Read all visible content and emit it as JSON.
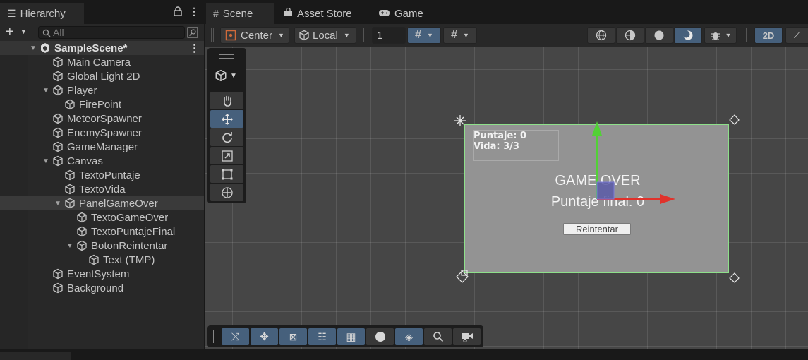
{
  "tabs": {
    "hierarchy": "Hierarchy",
    "scene": "Scene",
    "asset_store": "Asset Store",
    "game": "Game"
  },
  "hierarchy": {
    "search_placeholder": "All",
    "scene_name": "SampleScene*",
    "items": [
      {
        "label": "Main Camera",
        "depth": 1,
        "arrow": ""
      },
      {
        "label": "Global Light 2D",
        "depth": 1,
        "arrow": ""
      },
      {
        "label": "Player",
        "depth": 1,
        "arrow": "down"
      },
      {
        "label": "FirePoint",
        "depth": 2,
        "arrow": ""
      },
      {
        "label": "MeteorSpawner",
        "depth": 1,
        "arrow": ""
      },
      {
        "label": "EnemySpawner",
        "depth": 1,
        "arrow": ""
      },
      {
        "label": "GameManager",
        "depth": 1,
        "arrow": ""
      },
      {
        "label": "Canvas",
        "depth": 1,
        "arrow": "down"
      },
      {
        "label": "TextoPuntaje",
        "depth": 2,
        "arrow": ""
      },
      {
        "label": "TextoVida",
        "depth": 2,
        "arrow": ""
      },
      {
        "label": "PanelGameOver",
        "depth": 2,
        "arrow": "down",
        "selected": true
      },
      {
        "label": "TextoGameOver",
        "depth": 3,
        "arrow": ""
      },
      {
        "label": "TextoPuntajeFinal",
        "depth": 3,
        "arrow": ""
      },
      {
        "label": "BotonReintentar",
        "depth": 3,
        "arrow": "down"
      },
      {
        "label": "Text (TMP)",
        "depth": 4,
        "arrow": ""
      },
      {
        "label": "EventSystem",
        "depth": 1,
        "arrow": ""
      },
      {
        "label": "Background",
        "depth": 1,
        "arrow": ""
      }
    ]
  },
  "scene_toolbar": {
    "pivot": "Center",
    "space": "Local",
    "snap_value": "1",
    "mode_2d": "2D"
  },
  "game_ui": {
    "puntaje": "Puntaje: 0",
    "vida": "Vida: 3/3",
    "game_over": "GAME OVER",
    "puntaje_final": "Puntaje final: 0",
    "reintentar": "Reintentar"
  },
  "colors": {
    "accent_blue": "#46607c",
    "panel": "#282828",
    "viewport": "#464646",
    "canvas_border": "#8ee08a",
    "axis_x": "#e0322b",
    "axis_y": "#52d136"
  }
}
